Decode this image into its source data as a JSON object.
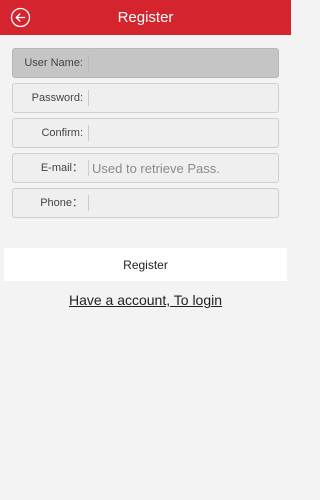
{
  "header": {
    "title": "Register",
    "back_icon": "back-arrow-circle-icon",
    "background_color": "#d4252e"
  },
  "form": {
    "fields": [
      {
        "label": "User Name:",
        "value": "",
        "placeholder": "",
        "focused": true
      },
      {
        "label": "Password:",
        "value": "",
        "placeholder": ""
      },
      {
        "label": "Confirm:",
        "value": "",
        "placeholder": ""
      },
      {
        "label": "E-mail：",
        "value": "",
        "placeholder": "Used to retrieve Pass."
      },
      {
        "label": "Phone：",
        "value": "",
        "placeholder": ""
      }
    ]
  },
  "actions": {
    "register_label": "Register",
    "login_link": "Have a account, To login"
  }
}
